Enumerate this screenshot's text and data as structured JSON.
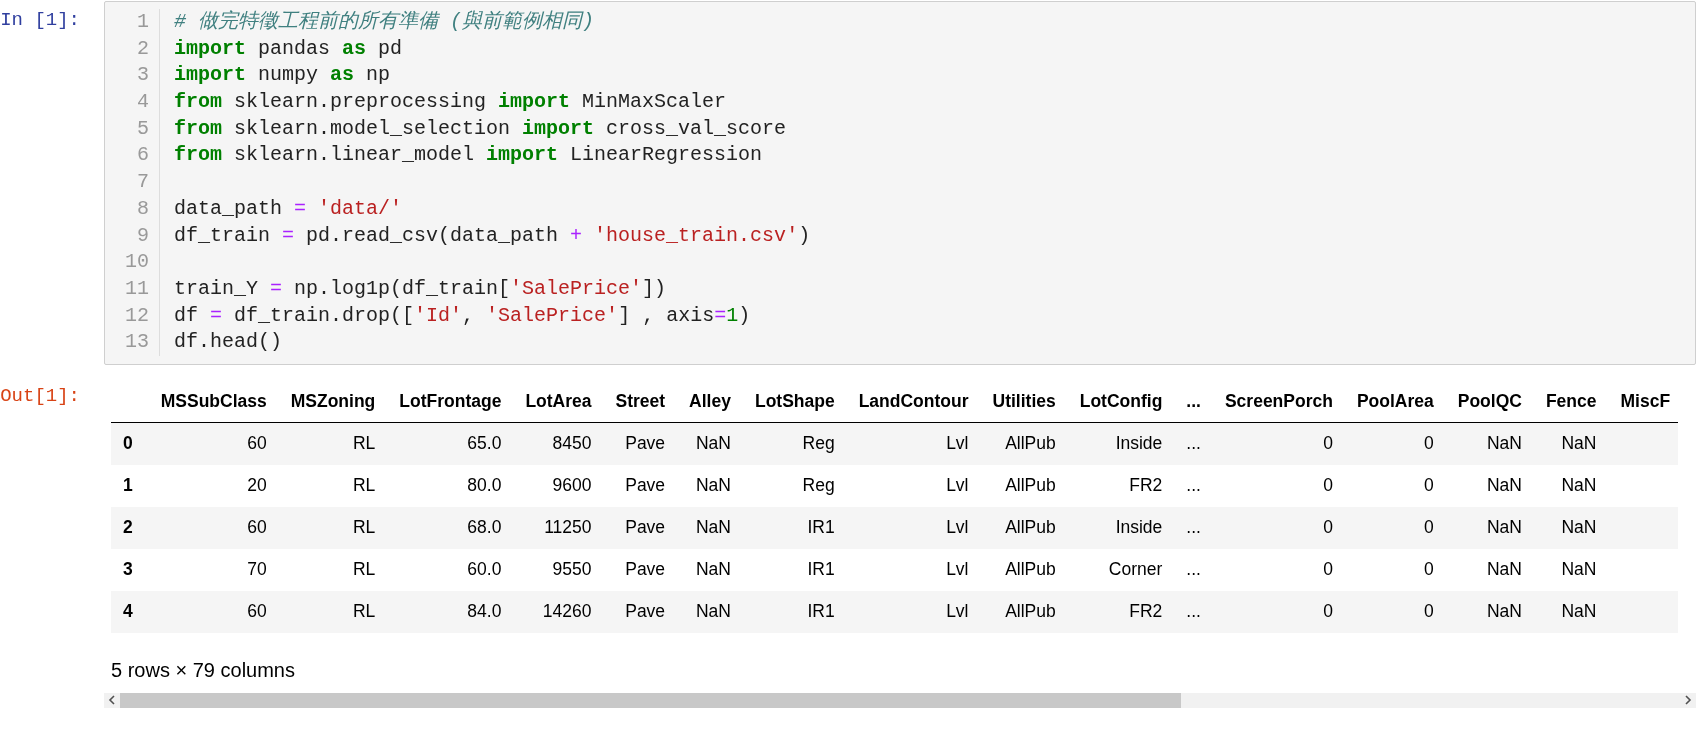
{
  "input_cell": {
    "prompt": "In [1]:",
    "lines": [
      {
        "number": "1",
        "tokens": [
          {
            "kind": "comment",
            "text": "# 做完特徵工程前的所有準備 (與前範例相同)"
          }
        ]
      },
      {
        "number": "2",
        "tokens": [
          {
            "kind": "keyword",
            "text": "import"
          },
          {
            "kind": "plain",
            "text": " pandas "
          },
          {
            "kind": "keyword",
            "text": "as"
          },
          {
            "kind": "plain",
            "text": " pd"
          }
        ]
      },
      {
        "number": "3",
        "tokens": [
          {
            "kind": "keyword",
            "text": "import"
          },
          {
            "kind": "plain",
            "text": " numpy "
          },
          {
            "kind": "keyword",
            "text": "as"
          },
          {
            "kind": "plain",
            "text": " np"
          }
        ]
      },
      {
        "number": "4",
        "tokens": [
          {
            "kind": "keyword",
            "text": "from"
          },
          {
            "kind": "plain",
            "text": " sklearn.preprocessing "
          },
          {
            "kind": "keyword",
            "text": "import"
          },
          {
            "kind": "plain",
            "text": " MinMaxScaler"
          }
        ]
      },
      {
        "number": "5",
        "tokens": [
          {
            "kind": "keyword",
            "text": "from"
          },
          {
            "kind": "plain",
            "text": " sklearn.model_selection "
          },
          {
            "kind": "keyword",
            "text": "import"
          },
          {
            "kind": "plain",
            "text": " cross_val_score"
          }
        ]
      },
      {
        "number": "6",
        "tokens": [
          {
            "kind": "keyword",
            "text": "from"
          },
          {
            "kind": "plain",
            "text": " sklearn.linear_model "
          },
          {
            "kind": "keyword",
            "text": "import"
          },
          {
            "kind": "plain",
            "text": " LinearRegression"
          }
        ]
      },
      {
        "number": "7"
      },
      {
        "number": "8",
        "tokens": [
          {
            "kind": "plain",
            "text": "data_path"
          },
          {
            "kind": "operator",
            "text": " = "
          },
          {
            "kind": "string",
            "text": "'data/'"
          }
        ]
      },
      {
        "number": "9",
        "tokens": [
          {
            "kind": "plain",
            "text": "df_train"
          },
          {
            "kind": "operator",
            "text": " = "
          },
          {
            "kind": "plain",
            "text": "pd.read_csv(data_path"
          },
          {
            "kind": "operator",
            "text": " + "
          },
          {
            "kind": "string",
            "text": "'house_train.csv'"
          },
          {
            "kind": "plain",
            "text": ")"
          }
        ]
      },
      {
        "number": "10"
      },
      {
        "number": "11",
        "tokens": [
          {
            "kind": "plain",
            "text": "train_Y "
          },
          {
            "kind": "operator",
            "text": "="
          },
          {
            "kind": "plain",
            "text": " np.log1p(df_train["
          },
          {
            "kind": "string",
            "text": "'SalePrice'"
          },
          {
            "kind": "plain",
            "text": "])"
          }
        ]
      },
      {
        "number": "12",
        "tokens": [
          {
            "kind": "plain",
            "text": "df "
          },
          {
            "kind": "operator",
            "text": "="
          },
          {
            "kind": "plain",
            "text": " df_train.drop(["
          },
          {
            "kind": "string",
            "text": "'Id'"
          },
          {
            "kind": "plain",
            "text": ", "
          },
          {
            "kind": "string",
            "text": "'SalePrice'"
          },
          {
            "kind": "plain",
            "text": "] , axis"
          },
          {
            "kind": "operator",
            "text": "="
          },
          {
            "kind": "number",
            "text": "1"
          },
          {
            "kind": "plain",
            "text": ")"
          }
        ]
      },
      {
        "number": "13",
        "tokens": [
          {
            "kind": "plain",
            "text": "df.head()"
          }
        ]
      }
    ]
  },
  "output_cell": {
    "prompt": "Out[1]:",
    "table": {
      "columns": [
        "MSSubClass",
        "MSZoning",
        "LotFrontage",
        "LotArea",
        "Street",
        "Alley",
        "LotShape",
        "LandContour",
        "Utilities",
        "LotConfig",
        "...",
        "ScreenPorch",
        "PoolArea",
        "PoolQC",
        "Fence",
        "MiscF"
      ],
      "rows": [
        {
          "index": "0",
          "cells": [
            "60",
            "RL",
            "65.0",
            "8450",
            "Pave",
            "NaN",
            "Reg",
            "Lvl",
            "AllPub",
            "Inside",
            "...",
            "0",
            "0",
            "NaN",
            "NaN"
          ]
        },
        {
          "index": "1",
          "cells": [
            "20",
            "RL",
            "80.0",
            "9600",
            "Pave",
            "NaN",
            "Reg",
            "Lvl",
            "AllPub",
            "FR2",
            "...",
            "0",
            "0",
            "NaN",
            "NaN"
          ]
        },
        {
          "index": "2",
          "cells": [
            "60",
            "RL",
            "68.0",
            "11250",
            "Pave",
            "NaN",
            "IR1",
            "Lvl",
            "AllPub",
            "Inside",
            "...",
            "0",
            "0",
            "NaN",
            "NaN"
          ]
        },
        {
          "index": "3",
          "cells": [
            "70",
            "RL",
            "60.0",
            "9550",
            "Pave",
            "NaN",
            "IR1",
            "Lvl",
            "AllPub",
            "Corner",
            "...",
            "0",
            "0",
            "NaN",
            "NaN"
          ]
        },
        {
          "index": "4",
          "cells": [
            "60",
            "RL",
            "84.0",
            "14260",
            "Pave",
            "NaN",
            "IR1",
            "Lvl",
            "AllPub",
            "FR2",
            "...",
            "0",
            "0",
            "NaN",
            "NaN"
          ]
        }
      ]
    },
    "summary": "5 rows × 79 columns"
  }
}
